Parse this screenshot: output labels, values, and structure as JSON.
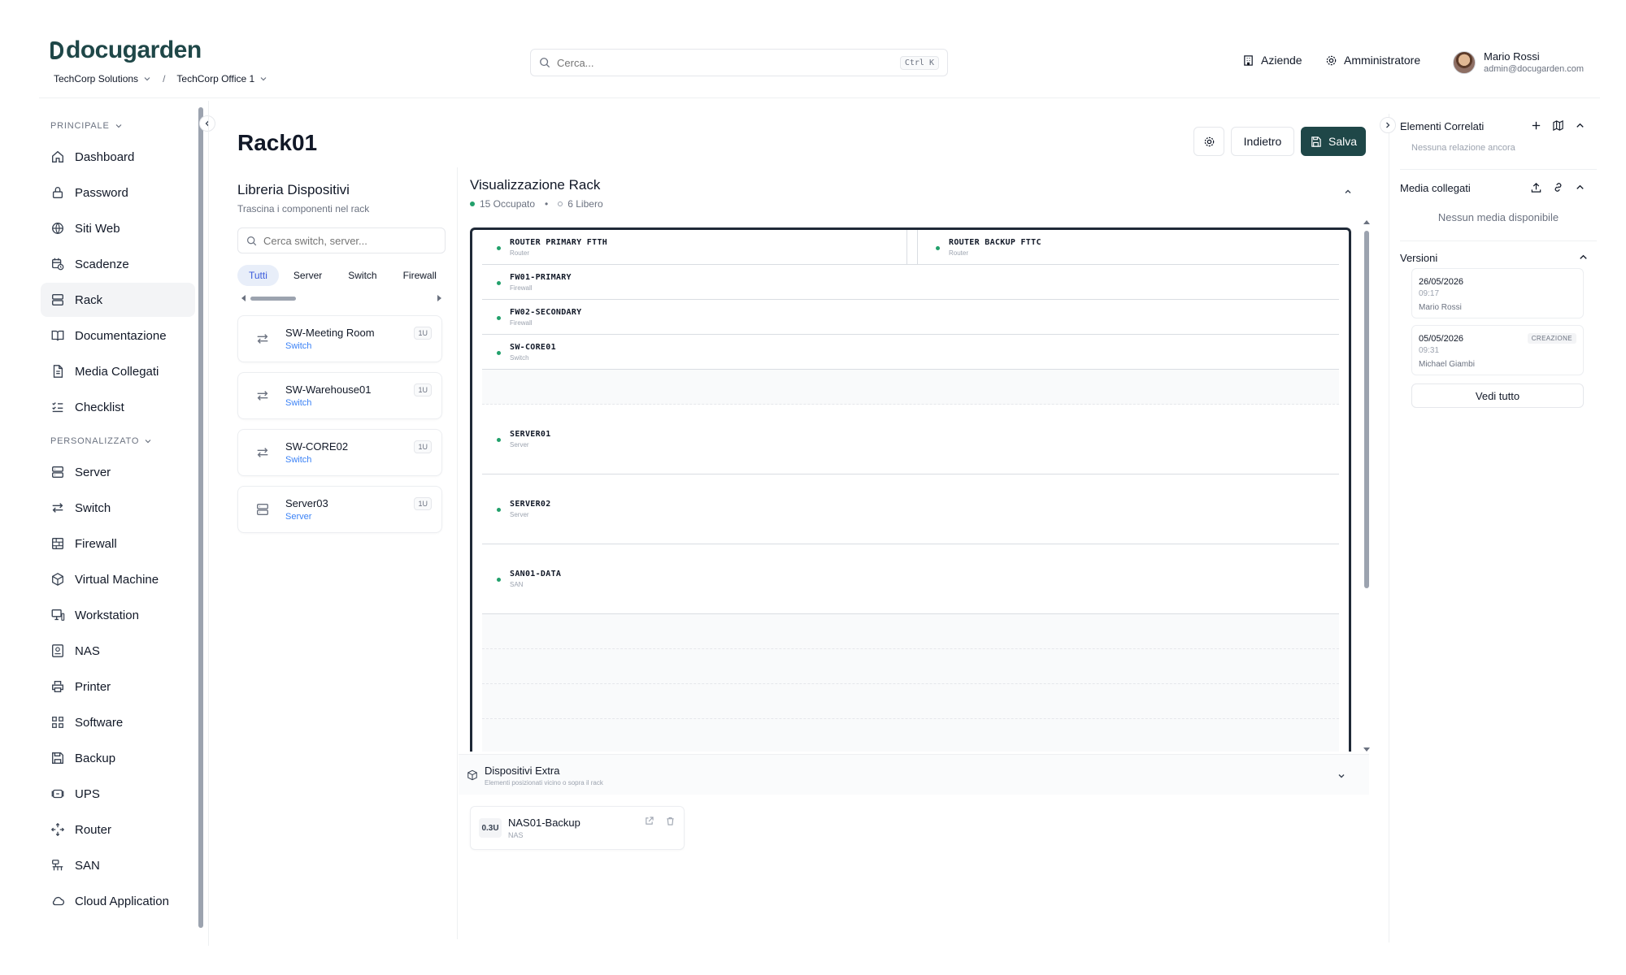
{
  "header": {
    "logo_text": "docugarden",
    "breadcrumb": {
      "company": "TechCorp Solutions",
      "office": "TechCorp Office 1"
    },
    "search": {
      "placeholder": "Cerca...",
      "shortcut": "Ctrl K"
    },
    "nav": {
      "companies": "Aziende",
      "admin": "Amministratore"
    },
    "user": {
      "name": "Mario Rossi",
      "email": "admin@docugarden.com"
    }
  },
  "sidebar": {
    "section_main": "PRINCIPALE",
    "main_items": [
      {
        "label": "Dashboard",
        "icon": "home-icon"
      },
      {
        "label": "Password",
        "icon": "lock-icon"
      },
      {
        "label": "Siti Web",
        "icon": "globe-icon"
      },
      {
        "label": "Scadenze",
        "icon": "calendar-clock-icon"
      },
      {
        "label": "Rack",
        "icon": "rack-icon",
        "active": true
      },
      {
        "label": "Documentazione",
        "icon": "book-icon"
      },
      {
        "label": "Media Collegati",
        "icon": "file-icon"
      },
      {
        "label": "Checklist",
        "icon": "checklist-icon"
      }
    ],
    "section_custom": "PERSONALIZZATO",
    "custom_items": [
      {
        "label": "Server",
        "icon": "server-icon"
      },
      {
        "label": "Switch",
        "icon": "switch-icon"
      },
      {
        "label": "Firewall",
        "icon": "firewall-icon"
      },
      {
        "label": "Virtual Machine",
        "icon": "cube-icon"
      },
      {
        "label": "Workstation",
        "icon": "workstation-icon"
      },
      {
        "label": "NAS",
        "icon": "nas-icon"
      },
      {
        "label": "Printer",
        "icon": "printer-icon"
      },
      {
        "label": "Software",
        "icon": "software-icon"
      },
      {
        "label": "Backup",
        "icon": "backup-icon"
      },
      {
        "label": "UPS",
        "icon": "ups-icon"
      },
      {
        "label": "Router",
        "icon": "router-icon"
      },
      {
        "label": "SAN",
        "icon": "san-icon"
      },
      {
        "label": "Cloud Application",
        "icon": "cloud-icon"
      }
    ]
  },
  "page": {
    "title": "Rack01",
    "back_label": "Indietro",
    "save_label": "Salva"
  },
  "library": {
    "title": "Libreria Dispositivi",
    "subtitle": "Trascina i componenti nel rack",
    "search_placeholder": "Cerca switch, server...",
    "filters": [
      "Tutti",
      "Server",
      "Switch",
      "Firewall"
    ],
    "active_filter": "Tutti",
    "devices": [
      {
        "name": "SW-Meeting Room",
        "type": "Switch",
        "units": "1U",
        "icon": "switch-icon"
      },
      {
        "name": "SW-Warehouse01",
        "type": "Switch",
        "units": "1U",
        "icon": "switch-icon"
      },
      {
        "name": "SW-CORE02",
        "type": "Switch",
        "units": "1U",
        "icon": "switch-icon"
      },
      {
        "name": "Server03",
        "type": "Server",
        "units": "1U",
        "icon": "server-icon"
      }
    ]
  },
  "rack_view": {
    "title": "Visualizzazione Rack",
    "occupied": "15 Occupato",
    "free": "6 Libero",
    "devices": [
      {
        "label": "ROUTER PRIMARY FTTH",
        "type": "Router"
      },
      {
        "label": "ROUTER BACKUP FTTC",
        "type": "Router"
      },
      {
        "label": "FW01-PRIMARY",
        "type": "Firewall"
      },
      {
        "label": "FW02-SECONDARY",
        "type": "Firewall"
      },
      {
        "label": "SW-CORE01",
        "type": "Switch"
      },
      {
        "label": "SERVER01",
        "type": "Server"
      },
      {
        "label": "SERVER02",
        "type": "Server"
      },
      {
        "label": "SAN01-DATA",
        "type": "SAN"
      }
    ]
  },
  "extra_devices": {
    "title": "Dispositivi Extra",
    "subtitle": "Elementi posizionati vicino o sopra il rack",
    "items": [
      {
        "units": "0.3U",
        "name": "NAS01-Backup",
        "type": "NAS"
      }
    ]
  },
  "right_panel": {
    "related_title": "Elementi Correlati",
    "related_empty": "Nessuna relazione ancora",
    "media_title": "Media collegati",
    "media_empty": "Nessun media disponibile",
    "versions_title": "Versioni",
    "versions": [
      {
        "date": "26/05/2026",
        "time": "09:17",
        "author": "Mario Rossi",
        "tag": ""
      },
      {
        "date": "05/05/2026",
        "time": "09:31",
        "author": "Michael Giambi",
        "tag": "CREAZIONE"
      }
    ],
    "view_all": "Vedi tutto"
  },
  "colors": {
    "brand": "#1f4748",
    "status_ok": "#22a06b",
    "type_link": "#3b82f6"
  }
}
